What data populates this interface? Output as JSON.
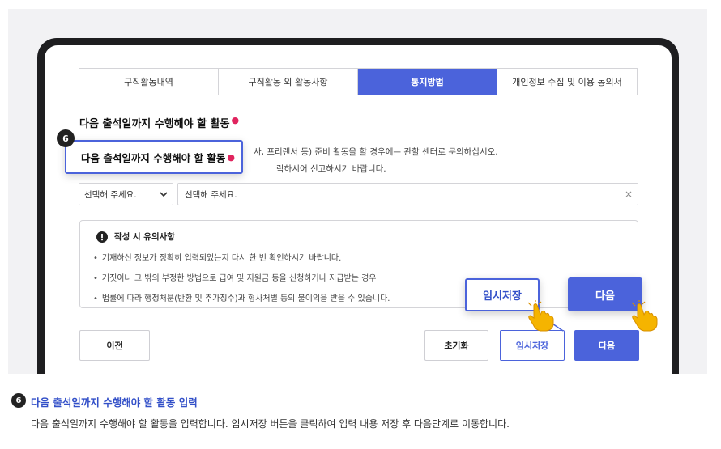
{
  "tabs": [
    {
      "label": "구직활동내역"
    },
    {
      "label": "구직활동 외 활동사항"
    },
    {
      "label": "통지방법"
    },
    {
      "label": "개인정보 수집 및 이용 동의서"
    }
  ],
  "form": {
    "section_title": "다음 출석일까지 수행해야 할 활동",
    "desc_line1": "사, 프리랜서 등) 준비 활동을 할 경우에는 관할 센터로 문의하십시오.",
    "desc_line2": "락하시어 신고하시기 바랍니다.",
    "select_value": "선택해 주세요.",
    "input_value": "선택해 주세요.",
    "clear_symbol": "×"
  },
  "callout": {
    "step": "6",
    "label": "다음 출석일까지 수행해야 할 활동"
  },
  "notice": {
    "title": "작성 시 유의사항",
    "items": [
      "기재하신 정보가 정확히 입력되었는지 다시 한 번 확인하시기 바랍니다.",
      "거짓이나 그 밖의 부정한 방법으로 급여 및 지원금 등을 신청하거나 지급받는 경우",
      "법률에 따라 행정처분(반환 및 추가징수)과 형사처벌 등의 불이익을 받을 수 있습니다."
    ]
  },
  "buttons": {
    "prev": "이전",
    "reset": "초기화",
    "temp_save": "임시저장",
    "next": "다음"
  },
  "highlight": {
    "temp_save": "임시저장",
    "next": "다음"
  },
  "caption": {
    "step": "6",
    "title": "다음 출석일까지 수행해야 할 활동 입력",
    "body": "다음 출석일까지 수행해야 할 활동을 입력합니다. 임시저장 버튼을 클릭하여 입력 내용 저장 후 다음단계로 이동합니다."
  },
  "colors": {
    "accent": "#4b63db",
    "required": "#e0245e"
  }
}
